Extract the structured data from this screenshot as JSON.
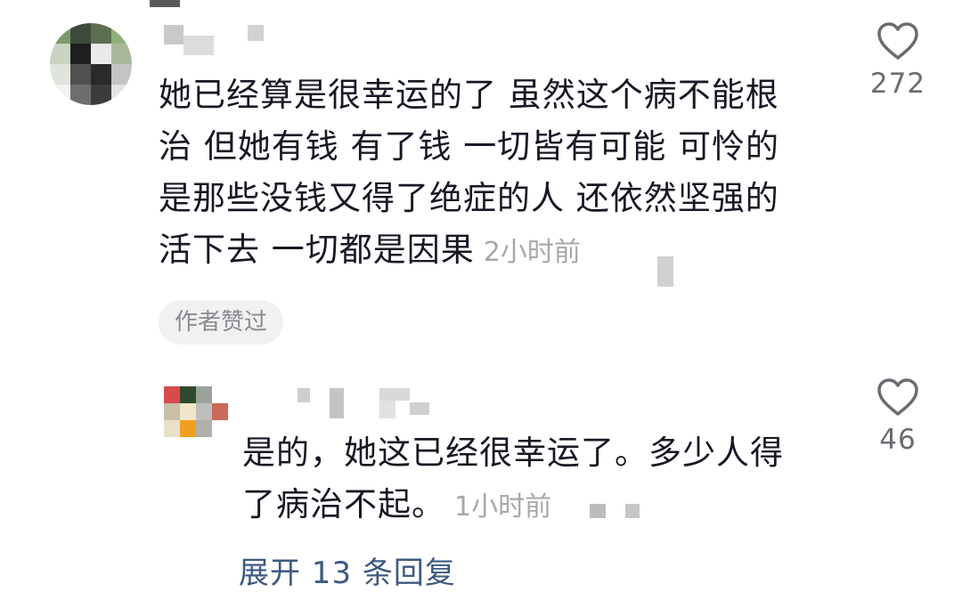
{
  "comments": [
    {
      "text_lines": [
        "她已经算是很幸运的了 虽然这个病不能根",
        "治 但她有钱 有了钱 一切皆有可能 可怜的",
        "是那些没钱又得了绝症的人 还依然坚强的",
        "活下去 一切都是因果"
      ],
      "time": "2小时前",
      "author_liked_label": "作者赞过",
      "like_count": "272"
    }
  ],
  "reply": {
    "text_lines": [
      "是的，她这已经很幸运了。多少人得",
      "了病治不起。"
    ],
    "time": "1小时前",
    "like_count": "46"
  },
  "expand_replies_label": "展开 13 条回复",
  "colors": {
    "text": "#161823",
    "muted": "#a8a8a8",
    "link": "#3d5a80",
    "badge_bg": "#f1f1f2"
  },
  "icons": {
    "like": "heart-outline-icon"
  }
}
